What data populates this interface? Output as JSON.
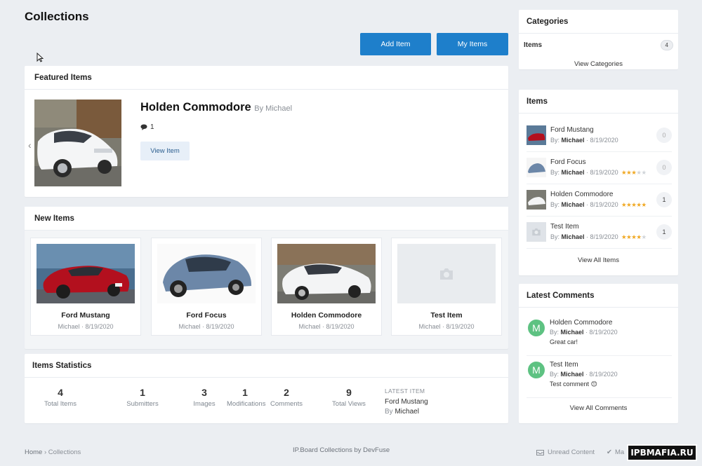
{
  "page": {
    "title": "Collections"
  },
  "actions": {
    "add_item": "Add Item",
    "my_items": "My Items"
  },
  "featured": {
    "heading": "Featured Items",
    "title": "Holden Commodore",
    "by": "By Michael",
    "comments": "1",
    "view_button": "View Item"
  },
  "new_items": {
    "heading": "New Items",
    "cards": [
      {
        "title": "Ford Mustang",
        "meta": "Michael · 8/19/2020"
      },
      {
        "title": "Ford Focus",
        "meta": "Michael · 8/19/2020"
      },
      {
        "title": "Holden Commodore",
        "meta": "Michael · 8/19/2020"
      },
      {
        "title": "Test Item",
        "meta": "Michael · 8/19/2020"
      }
    ]
  },
  "stats": {
    "heading": "Items Statistics",
    "items": [
      {
        "num": "4",
        "label": "Total Items"
      },
      {
        "num": "1",
        "label": "Submitters"
      },
      {
        "num": "3",
        "label": "Images"
      },
      {
        "num": "1",
        "label": "Modifications"
      },
      {
        "num": "2",
        "label": "Comments"
      },
      {
        "num": "9",
        "label": "Total Views"
      }
    ],
    "latest_label": "LATEST ITEM",
    "latest_title": "Ford Mustang",
    "latest_by_prefix": "By",
    "latest_by_name": "Michael"
  },
  "categories": {
    "heading": "Categories",
    "item_label": "Items",
    "item_count": "4",
    "view_link": "View Categories"
  },
  "items_widget": {
    "heading": "Items",
    "by_prefix": "By:",
    "rows": [
      {
        "title": "Ford Mustang",
        "author": "Michael",
        "date": "· 8/19/2020",
        "rating": 0,
        "count": "0"
      },
      {
        "title": "Ford Focus",
        "author": "Michael",
        "date": "· 8/19/2020",
        "rating": 3,
        "count": "0"
      },
      {
        "title": "Holden Commodore",
        "author": "Michael",
        "date": "· 8/19/2020",
        "rating": 5,
        "count": "1"
      },
      {
        "title": "Test Item",
        "author": "Michael",
        "date": "· 8/19/2020",
        "rating": 4,
        "count": "1"
      }
    ],
    "view_all": "View All Items"
  },
  "latest_comments": {
    "heading": "Latest Comments",
    "by_prefix": "By:",
    "rows": [
      {
        "avatar": "M",
        "title": "Holden Commodore",
        "author": "Michael",
        "date": "· 8/19/2020",
        "text": "Great car!"
      },
      {
        "avatar": "M",
        "title": "Test Item",
        "author": "Michael",
        "date": "· 8/19/2020",
        "text": "Test comment 😊"
      }
    ],
    "view_all": "View All Comments"
  },
  "footer": {
    "breadcrumb_home": "Home",
    "breadcrumb_sep": "›",
    "breadcrumb_current": "Collections",
    "credit": "IP.Board Collections by DevFuse",
    "unread": "Unread Content",
    "mark": "Ma",
    "watermark": "IPBMAFIA.RU"
  },
  "colors": {
    "accent": "#1e7fcb",
    "star": "#f0a821",
    "avatar": "#5ec282"
  }
}
